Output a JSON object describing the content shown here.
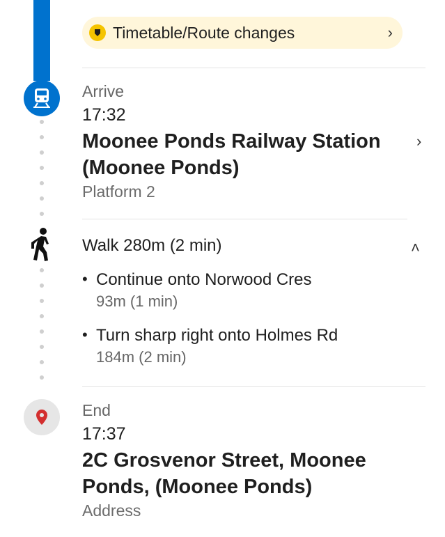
{
  "notice": {
    "label": "Timetable/Route changes",
    "icon": "warning-icon",
    "chevron": "›"
  },
  "arrive": {
    "label": "Arrive",
    "time": "17:32",
    "title_line1": "Moonee Ponds Railway Station",
    "title_line2": "(Moonee Ponds)",
    "platform": "Platform 2",
    "chevron": "›"
  },
  "walk": {
    "summary": "Walk 280m (2 min)",
    "collapse_chevron": "˄",
    "steps": [
      {
        "bullet": "•",
        "instruction": "Continue onto Norwood Cres",
        "detail": "93m (1 min)"
      },
      {
        "bullet": "•",
        "instruction": "Turn sharp right onto Holmes Rd",
        "detail": "184m (2 min)"
      }
    ]
  },
  "end": {
    "label": "End",
    "time": "17:37",
    "title_line1": "2C Grosvenor Street, Moonee",
    "title_line2": "Ponds, (Moonee Ponds)",
    "type": "Address"
  },
  "colors": {
    "route": "#0072ce",
    "notice_bg": "#fff6da",
    "warning": "#f5c400",
    "pin": "#d32f2f"
  }
}
